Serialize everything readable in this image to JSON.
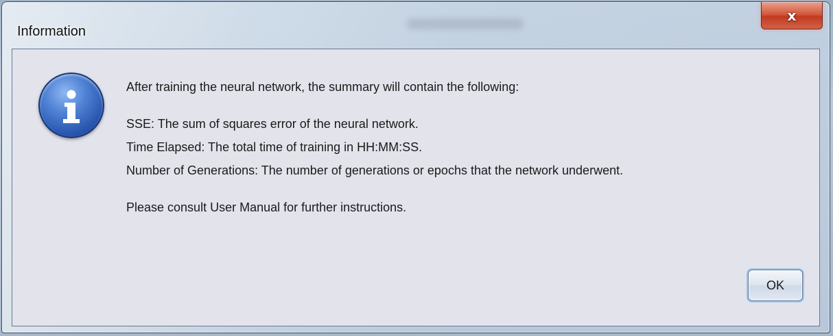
{
  "window": {
    "title": "Information",
    "close_glyph": "x"
  },
  "dialog": {
    "icon": "info-icon",
    "lines": [
      "After training the neural network, the summary will contain the following:",
      "SSE: The sum of squares error of the neural network.",
      "Time Elapsed: The total time of training in HH:MM:SS.",
      "Number of Generations: The number of generations or epochs that the network underwent.",
      "Please consult User Manual for further instructions."
    ],
    "ok_label": "OK"
  },
  "colors": {
    "icon_blue": "#2a57b0",
    "close_red": "#c13a22",
    "client_bg": "#e3e3ec"
  }
}
